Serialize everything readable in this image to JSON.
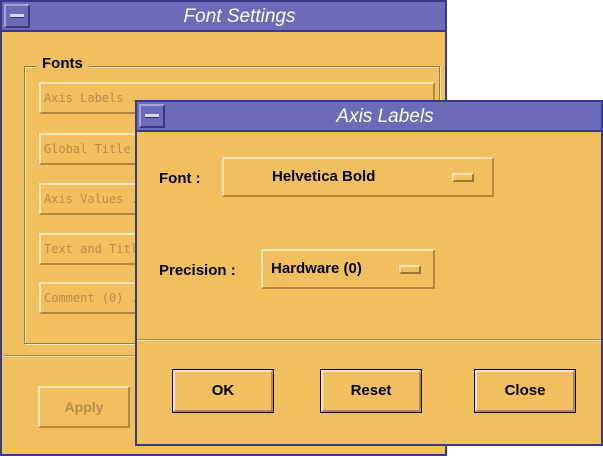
{
  "font_settings": {
    "title": "Font Settings",
    "group_title": "Fonts",
    "buttons": [
      "Axis Labels ...",
      "Global Title ...",
      "Axis Values ...",
      "Text and Titles ...",
      "Comment (0) ..."
    ],
    "apply_label": "Apply"
  },
  "axis_labels": {
    "title": "Axis Labels",
    "font_label": "Font :",
    "font_value": "Helvetica Bold",
    "precision_label": "Precision :",
    "precision_value": "Hardware (0)",
    "ok_label": "OK",
    "reset_label": "Reset",
    "close_label": "Close"
  },
  "colors": {
    "window_bg": "#f2bf5e",
    "titlebar": "#6b6bb8",
    "border": "#3a3a8c",
    "disabled_text": "#b58e4a"
  }
}
